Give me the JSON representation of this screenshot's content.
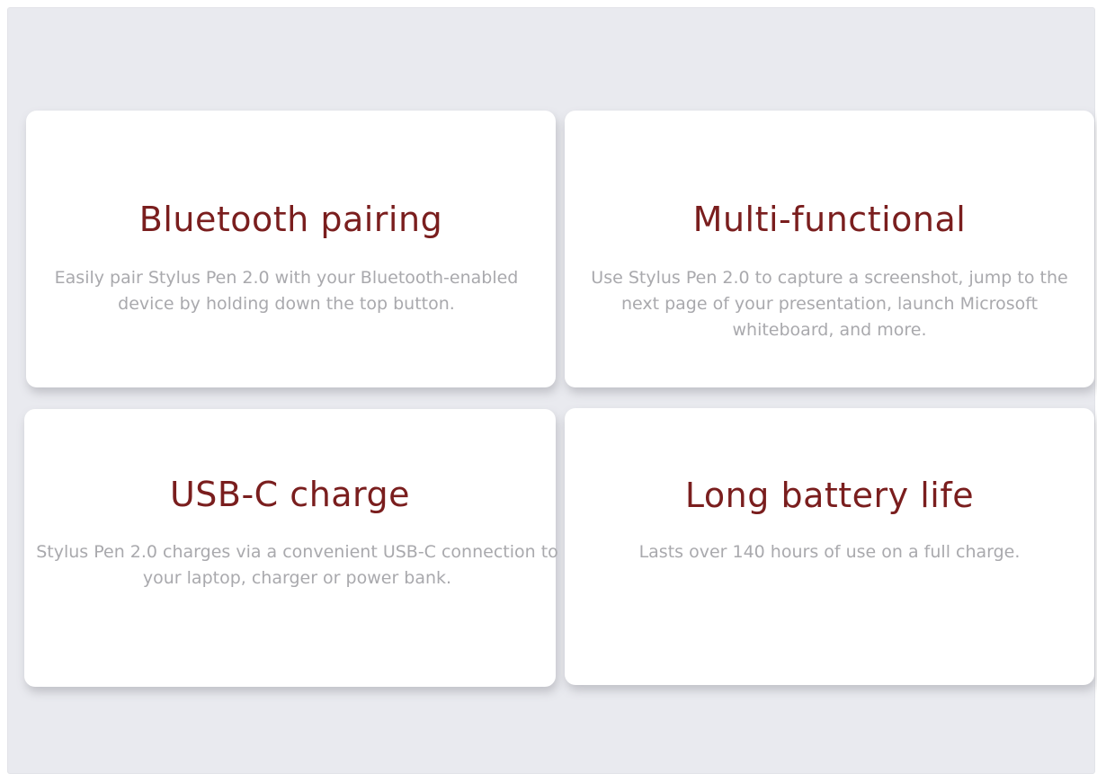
{
  "features": [
    {
      "title": "Bluetooth pairing",
      "description": "Easily pair Stylus Pen 2.0 with your Bluetooth-enabled device by holding down the top button."
    },
    {
      "title": "Multi-functional",
      "description": "Use Stylus Pen 2.0 to capture a screenshot, jump to the next page of your presentation, launch Microsoft whiteboard, and more."
    },
    {
      "title": "USB-C charge",
      "description": "Stylus Pen 2.0 charges via a convenient USB-C connection to your laptop, charger or power bank."
    },
    {
      "title": "Long battery life",
      "description": "Lasts over 140 hours of use on a full charge."
    }
  ],
  "colors": {
    "background": "#e9eaef",
    "card": "#ffffff",
    "title": "#7a1e1e",
    "description": "#a9a9ad"
  }
}
